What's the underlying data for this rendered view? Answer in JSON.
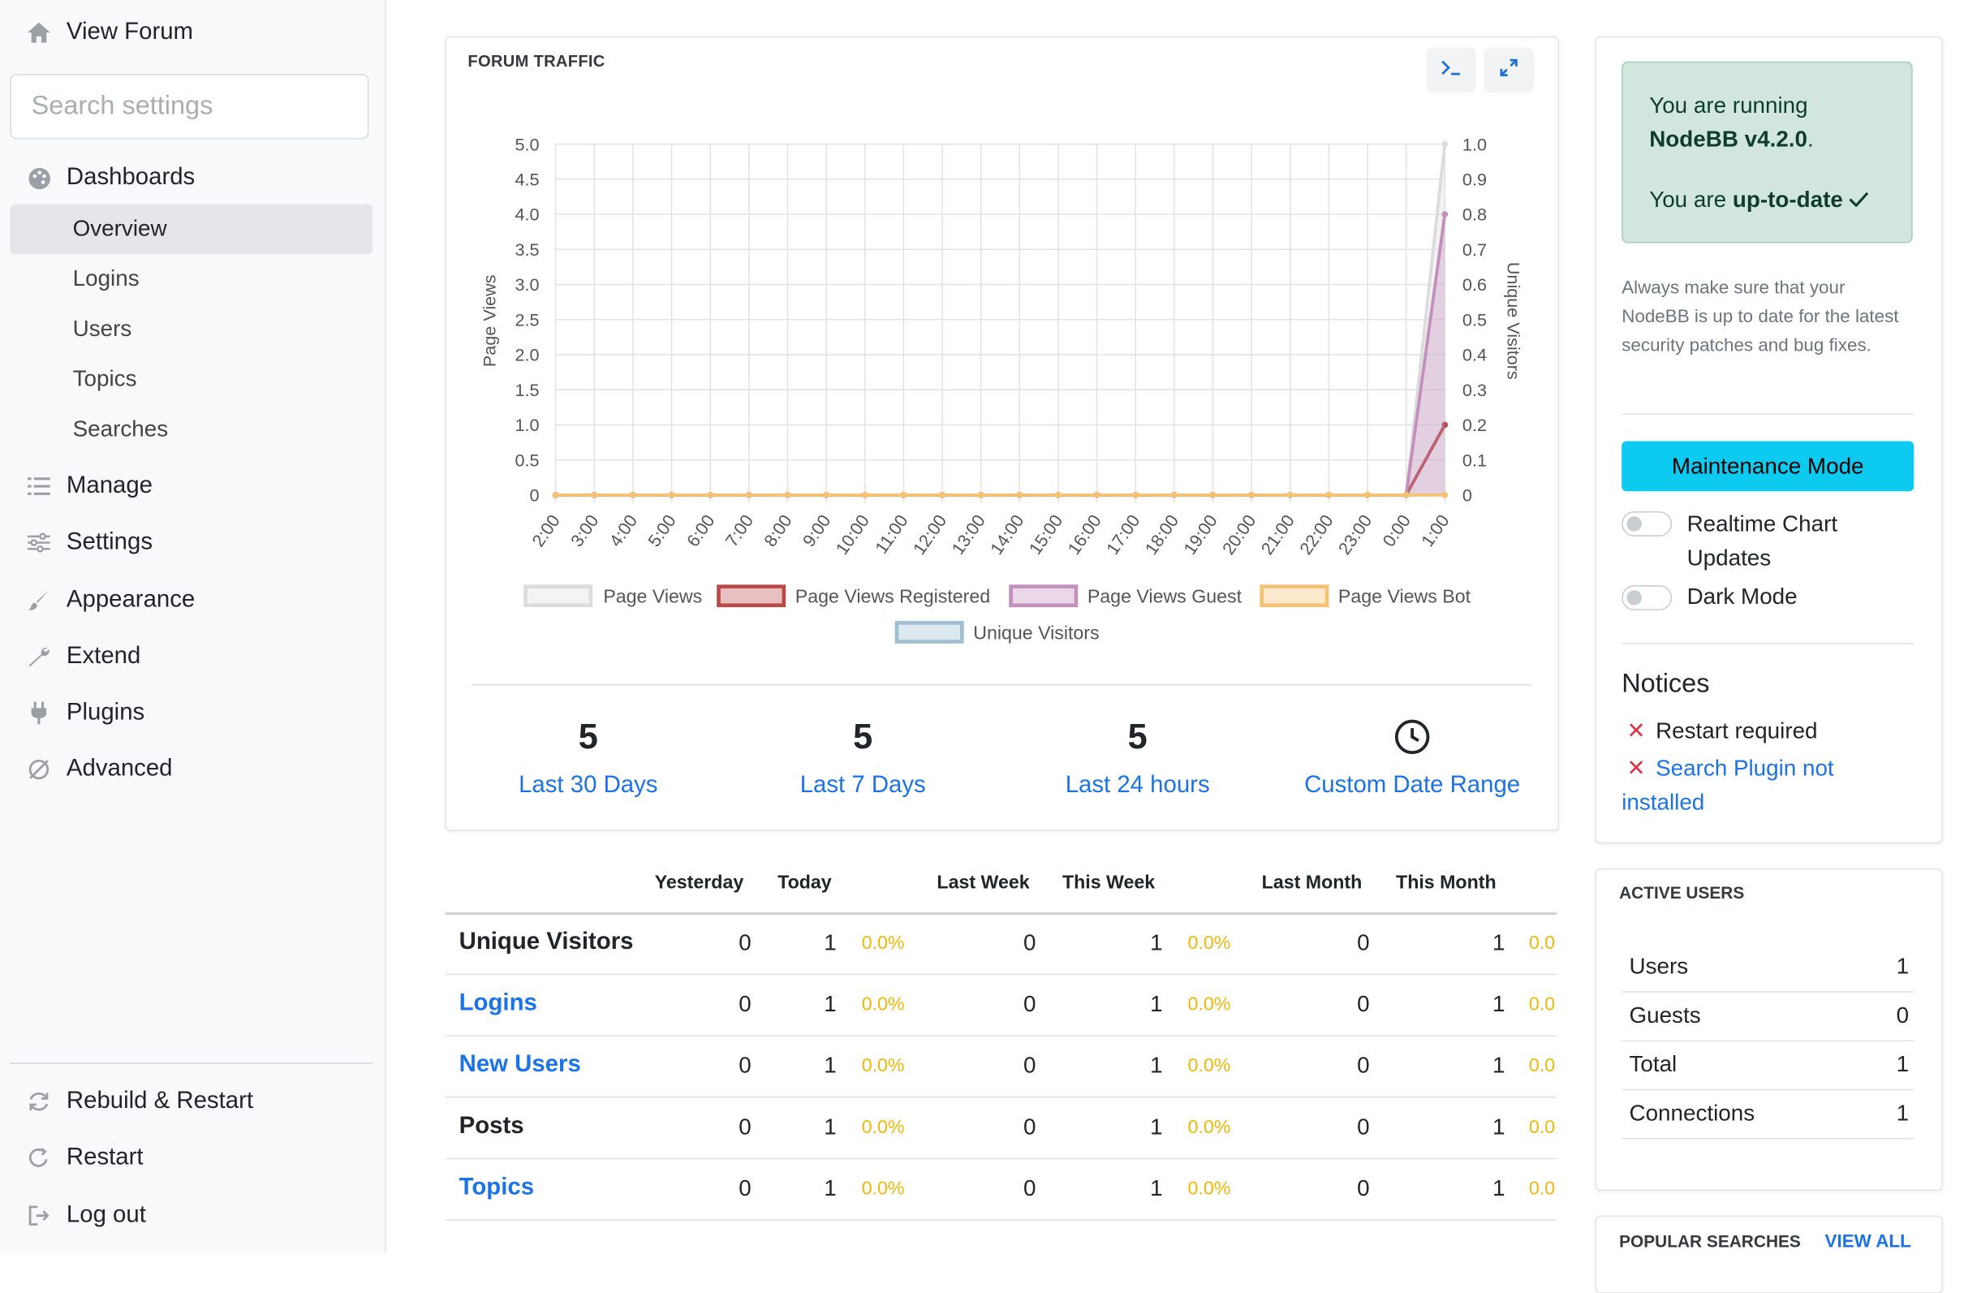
{
  "sidebar": {
    "view_forum": "View Forum",
    "search_placeholder": "Search settings",
    "dashboards": "Dashboards",
    "sub_items": [
      "Overview",
      "Logins",
      "Users",
      "Topics",
      "Searches"
    ],
    "manage": "Manage",
    "settings": "Settings",
    "appearance": "Appearance",
    "extend": "Extend",
    "plugins": "Plugins",
    "advanced": "Advanced",
    "rebuild_restart": "Rebuild & Restart",
    "restart": "Restart",
    "logout": "Log out"
  },
  "traffic": {
    "title": "FORUM TRAFFIC",
    "stats": [
      {
        "value": "5",
        "label": "Last 30 Days"
      },
      {
        "value": "5",
        "label": "Last 7 Days"
      },
      {
        "value": "5",
        "label": "Last 24 hours"
      },
      {
        "value": "",
        "label": "Custom Date Range"
      }
    ]
  },
  "chart_data": {
    "type": "line",
    "title": "",
    "ylabel": "Page Views",
    "y2label": "Unique Visitors",
    "ylim": [
      0,
      5.0
    ],
    "y2lim": [
      0,
      1.0
    ],
    "yticks": [
      "5.0",
      "4.5",
      "4.0",
      "3.5",
      "3.0",
      "2.5",
      "2.0",
      "1.5",
      "1.0",
      "0.5",
      "0"
    ],
    "y2ticks": [
      "1.0",
      "0.9",
      "0.8",
      "0.7",
      "0.6",
      "0.5",
      "0.4",
      "0.3",
      "0.2",
      "0.1",
      "0"
    ],
    "x": [
      "2:00",
      "3:00",
      "4:00",
      "5:00",
      "6:00",
      "7:00",
      "8:00",
      "9:00",
      "10:00",
      "11:00",
      "12:00",
      "13:00",
      "14:00",
      "15:00",
      "16:00",
      "17:00",
      "18:00",
      "19:00",
      "20:00",
      "21:00",
      "22:00",
      "23:00",
      "0:00",
      "1:00"
    ],
    "series": [
      {
        "name": "Page Views",
        "color": "#dcdcdc",
        "values": [
          0,
          0,
          0,
          0,
          0,
          0,
          0,
          0,
          0,
          0,
          0,
          0,
          0,
          0,
          0,
          0,
          0,
          0,
          0,
          0,
          0,
          0,
          0,
          5
        ]
      },
      {
        "name": "Page Views Registered",
        "color": "#b94a48",
        "values": [
          0,
          0,
          0,
          0,
          0,
          0,
          0,
          0,
          0,
          0,
          0,
          0,
          0,
          0,
          0,
          0,
          0,
          0,
          0,
          0,
          0,
          0,
          0,
          1
        ]
      },
      {
        "name": "Page Views Guest",
        "color": "#c38fbc",
        "values": [
          0,
          0,
          0,
          0,
          0,
          0,
          0,
          0,
          0,
          0,
          0,
          0,
          0,
          0,
          0,
          0,
          0,
          0,
          0,
          0,
          0,
          0,
          0,
          4
        ]
      },
      {
        "name": "Page Views Bot",
        "color": "#f5c173",
        "values": [
          0,
          0,
          0,
          0,
          0,
          0,
          0,
          0,
          0,
          0,
          0,
          0,
          0,
          0,
          0,
          0,
          0,
          0,
          0,
          0,
          0,
          0,
          0,
          0
        ]
      },
      {
        "name": "Unique Visitors",
        "color": "#9fbfd2",
        "values": [
          0,
          0,
          0,
          0,
          0,
          0,
          0,
          0,
          0,
          0,
          0,
          0,
          0,
          0,
          0,
          0,
          0,
          0,
          0,
          0,
          0,
          0,
          0,
          1
        ]
      }
    ],
    "grid": true,
    "legend_position": "bottom"
  },
  "table": {
    "headers": [
      "Yesterday",
      "Today",
      "Last Week",
      "This Week",
      "Last Month",
      "This Month"
    ],
    "rows": [
      {
        "label": "Unique Visitors",
        "link": false,
        "yesterday": "0",
        "today": "1",
        "pct1": "0.0%",
        "last_week": "0",
        "this_week": "1",
        "pct2": "0.0%",
        "last_month": "0",
        "this_month": "1",
        "pct3": "0.0"
      },
      {
        "label": "Logins",
        "link": true,
        "yesterday": "0",
        "today": "1",
        "pct1": "0.0%",
        "last_week": "0",
        "this_week": "1",
        "pct2": "0.0%",
        "last_month": "0",
        "this_month": "1",
        "pct3": "0.0"
      },
      {
        "label": "New Users",
        "link": true,
        "yesterday": "0",
        "today": "1",
        "pct1": "0.0%",
        "last_week": "0",
        "this_week": "1",
        "pct2": "0.0%",
        "last_month": "0",
        "this_month": "1",
        "pct3": "0.0"
      },
      {
        "label": "Posts",
        "link": false,
        "yesterday": "0",
        "today": "1",
        "pct1": "0.0%",
        "last_week": "0",
        "this_week": "1",
        "pct2": "0.0%",
        "last_month": "0",
        "this_month": "1",
        "pct3": "0.0"
      },
      {
        "label": "Topics",
        "link": true,
        "yesterday": "0",
        "today": "1",
        "pct1": "0.0%",
        "last_week": "0",
        "this_week": "1",
        "pct2": "0.0%",
        "last_month": "0",
        "this_month": "1",
        "pct3": "0.0"
      }
    ]
  },
  "version": {
    "running_prefix": "You are running",
    "version": "NodeBB v4.2.0",
    "status_prefix": "You are",
    "status": "up-to-date",
    "note": "Always make sure that your NodeBB is up to date for the latest security patches and bug fixes."
  },
  "controls": {
    "maintenance": "Maintenance Mode",
    "realtime": "Realtime Chart Updates",
    "dark_mode": "Dark Mode"
  },
  "notices": {
    "title": "Notices",
    "restart_required": "Restart required",
    "search_plugin": "Search Plugin not installed"
  },
  "active_users": {
    "title": "ACTIVE USERS",
    "rows": [
      {
        "label": "Users",
        "value": "1"
      },
      {
        "label": "Guests",
        "value": "0"
      },
      {
        "label": "Total",
        "value": "1"
      },
      {
        "label": "Connections",
        "value": "1"
      }
    ]
  },
  "popular_searches": {
    "title": "POPULAR SEARCHES",
    "view_all": "VIEW ALL"
  },
  "colors": {
    "accent": "#1a73e8",
    "maintenance_button": "#0dcaf0",
    "up_to_date_bg": "#d1e7dd",
    "percent": "#f2b705",
    "notice_x": "#dc3545"
  }
}
